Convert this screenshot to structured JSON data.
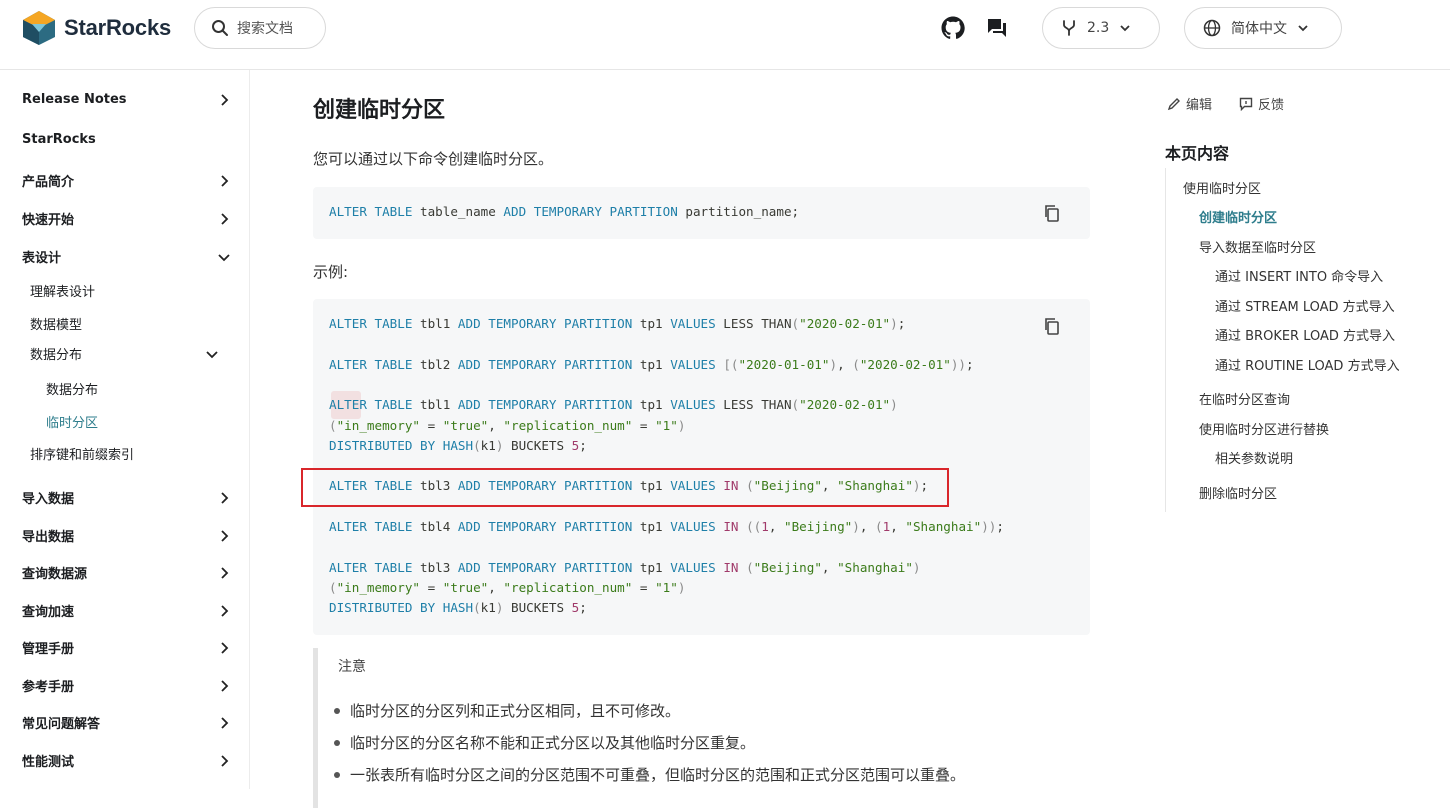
{
  "header": {
    "brand": "StarRocks",
    "search_placeholder": "搜索文档",
    "version": "2.3",
    "language": "简体中文",
    "icons": [
      "github-icon",
      "chat-icon",
      "branch-icon",
      "globe-icon"
    ]
  },
  "sidebar": {
    "items": [
      {
        "label": "Release Notes"
      },
      {
        "label": "StarRocks"
      },
      {
        "label": "产品简介"
      },
      {
        "label": "快速开始"
      },
      {
        "label": "表设计"
      },
      {
        "label": "理解表设计"
      },
      {
        "label": "数据模型"
      },
      {
        "label": "数据分布"
      },
      {
        "label": "数据分布"
      },
      {
        "label": "临时分区"
      },
      {
        "label": "排序键和前缀索引"
      },
      {
        "label": "导入数据"
      },
      {
        "label": "导出数据"
      },
      {
        "label": "查询数据源"
      },
      {
        "label": "查询加速"
      },
      {
        "label": "管理手册"
      },
      {
        "label": "参考手册"
      },
      {
        "label": "常见问题解答"
      },
      {
        "label": "性能测试"
      }
    ]
  },
  "main": {
    "title": "创建临时分区",
    "intro": "您可以通过以下命令创建临时分区。",
    "example_label": "示例:",
    "note_title": "注意",
    "notes": [
      "临时分区的分区列和正式分区相同，且不可修改。",
      "临时分区的分区名称不能和正式分区以及其他临时分区重复。",
      "一张表所有临时分区之间的分区范围不可重叠，但临时分区的范围和正式分区范围可以重叠。"
    ]
  },
  "code1": {
    "lines": [
      "ALTER TABLE table_name ADD TEMPORARY PARTITION partition_name;"
    ]
  },
  "code2": {
    "lines": [
      "ALTER TABLE tbl1 ADD TEMPORARY PARTITION tp1 VALUES LESS THAN(\"2020-02-01\");",
      "ALTER TABLE tbl2 ADD TEMPORARY PARTITION tp1 VALUES [(\"2020-01-01\"), (\"2020-02-01\"));",
      "ALTER TABLE tbl1 ADD TEMPORARY PARTITION tp1 VALUES LESS THAN(\"2020-02-01\")",
      "(\"in_memory\" = \"true\", \"replication_num\" = \"1\")",
      "DISTRIBUTED BY HASH(k1) BUCKETS 5;",
      "ALTER TABLE tbl3 ADD TEMPORARY PARTITION tp1 VALUES IN (\"Beijing\", \"Shanghai\");",
      "ALTER TABLE tbl4 ADD TEMPORARY PARTITION tp1 VALUES IN ((1, \"Beijing\"), (1, \"Shanghai\"));",
      "ALTER TABLE tbl3 ADD TEMPORARY PARTITION tp1 VALUES IN (\"Beijing\", \"Shanghai\")",
      "(\"in_memory\" = \"true\", \"replication_num\" = \"1\")",
      "DISTRIBUTED BY HASH(k1) BUCKETS 5;"
    ]
  },
  "toc": {
    "edit": "编辑",
    "feedback": "反馈",
    "title": "本页内容",
    "items": [
      {
        "label": "使用临时分区"
      },
      {
        "label": "创建临时分区"
      },
      {
        "label": "导入数据至临时分区"
      },
      {
        "label": "通过 INSERT INTO 命令导入"
      },
      {
        "label": "通过 STREAM LOAD 方式导入"
      },
      {
        "label": "通过 BROKER LOAD 方式导入"
      },
      {
        "label": "通过 ROUTINE LOAD 方式导入"
      },
      {
        "label": "在临时分区查询"
      },
      {
        "label": "使用临时分区进行替换"
      },
      {
        "label": "相关参数说明"
      },
      {
        "label": "删除临时分区"
      }
    ]
  },
  "colors": {
    "accent": "#2e7d8c",
    "keyword": "#1e7fa8",
    "string": "#3b7b1a",
    "highlight_border": "#d9262b"
  }
}
